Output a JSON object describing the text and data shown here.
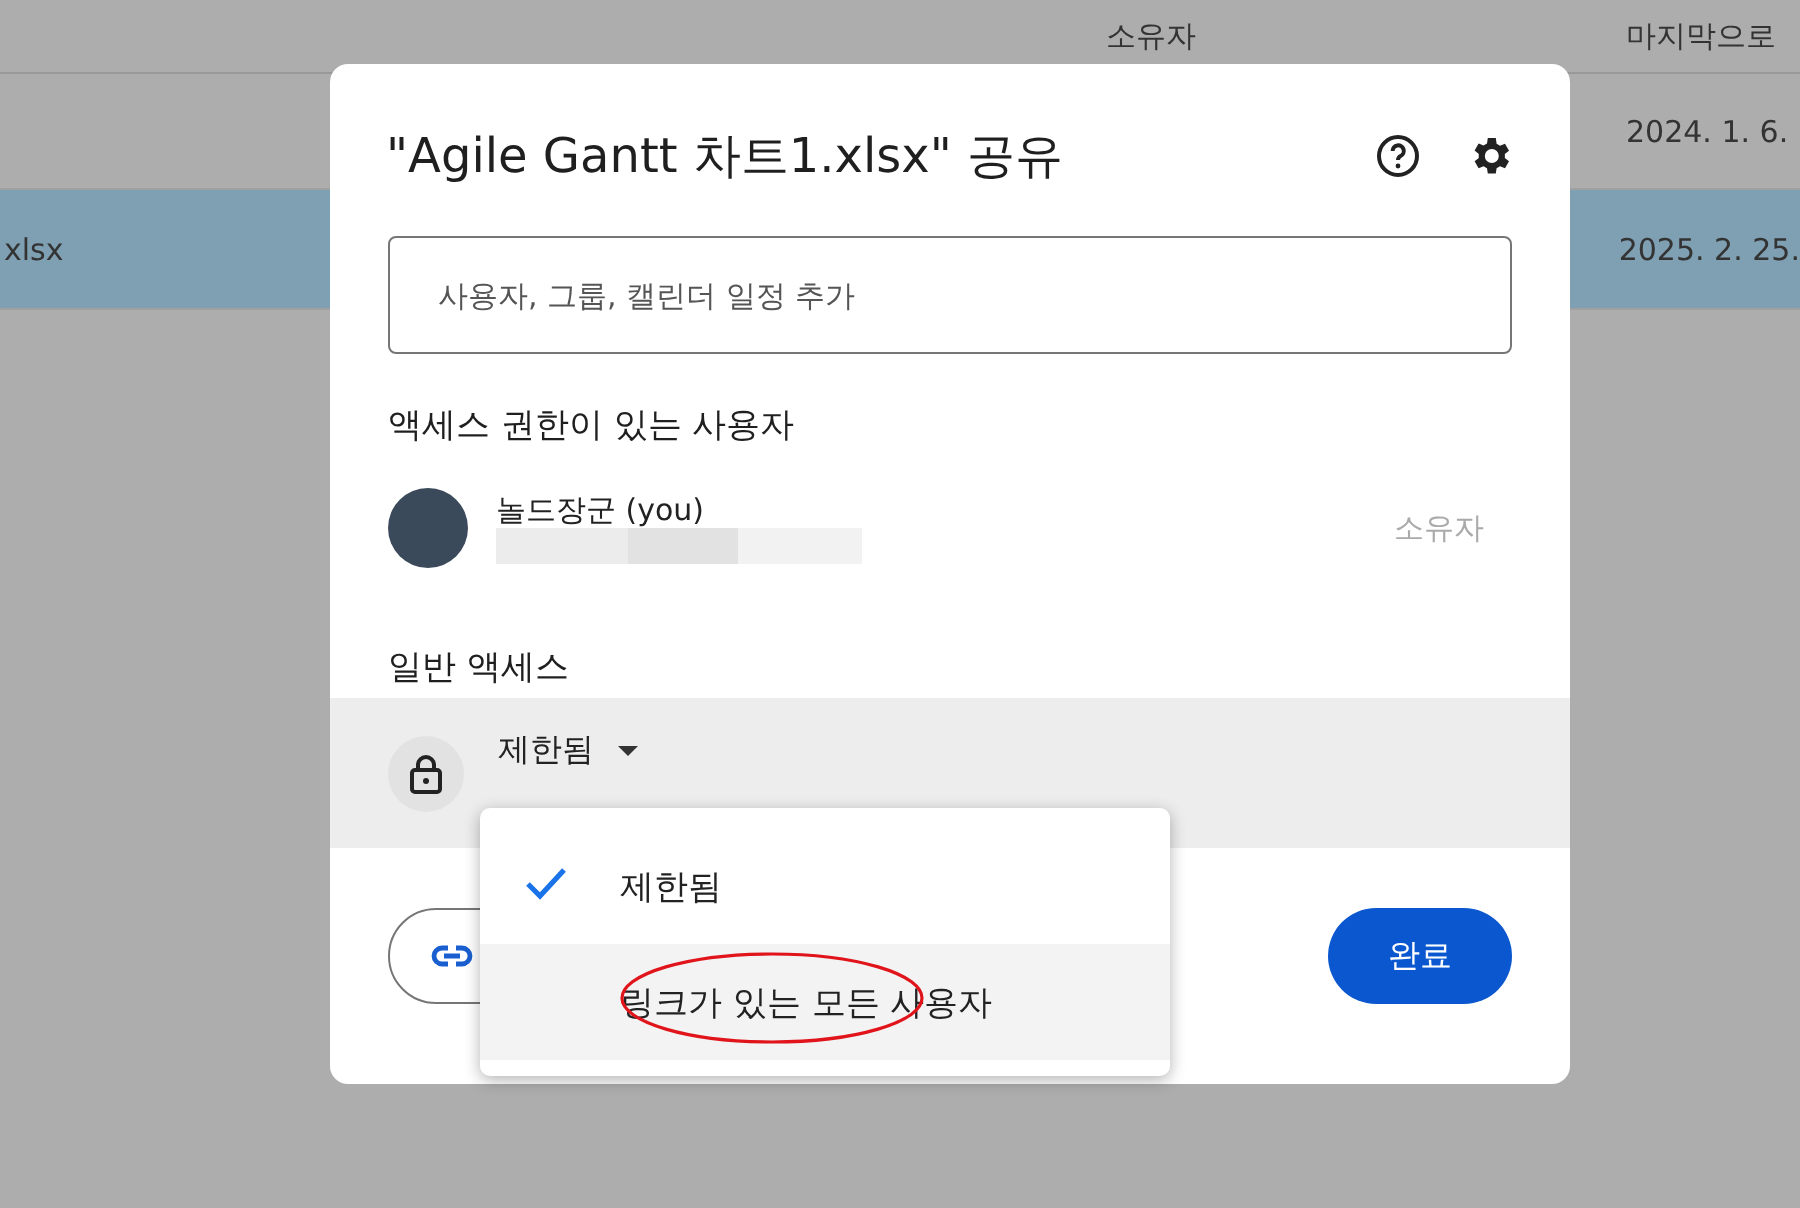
{
  "file_list": {
    "columns": [
      {
        "label": "소유자"
      },
      {
        "label": "마지막으로"
      }
    ],
    "rows": [
      {
        "modified": "2024. 1. 6.",
        "selected": false
      },
      {
        "name": "xlsx",
        "modified": "2025. 2. 25.",
        "selected": true
      }
    ]
  },
  "dialog": {
    "title": "\"Agile Gantt 차트1.xlsx\" 공유",
    "search": {
      "placeholder": "사용자, 그룹, 캘린더 일정 추가"
    },
    "people_heading": "액세스 권한이 있는 사용자",
    "people": [
      {
        "name": "놀드장군 (you)",
        "role": "소유자"
      }
    ],
    "general_access_heading": "일반 액세스",
    "access": {
      "value": "제한됨"
    },
    "menu": [
      {
        "label": "제한됨",
        "selected": true,
        "highlighted": false
      },
      {
        "label": "링크가 있는 모든 사용자",
        "selected": false,
        "highlighted": true
      }
    ],
    "done_button": "완료"
  }
}
